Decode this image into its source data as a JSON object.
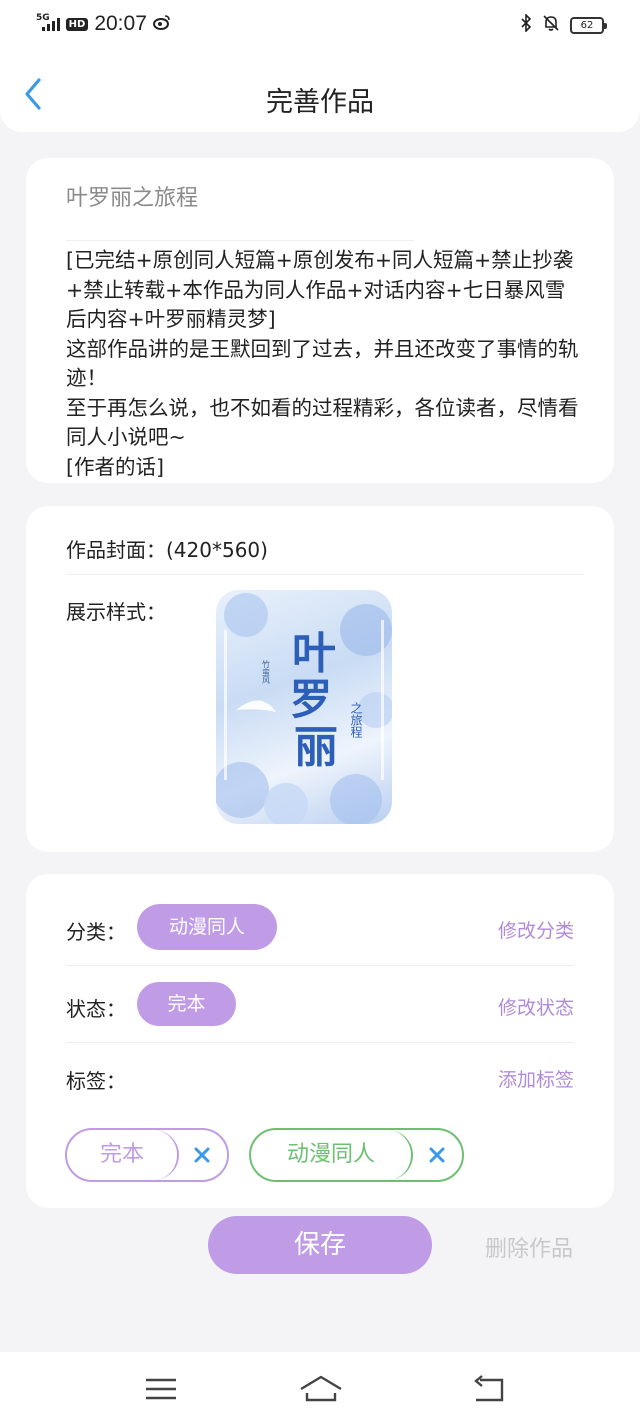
{
  "status_bar": {
    "network": "5G",
    "hd": "HD",
    "time": "20:07",
    "battery": "62",
    "icons": [
      "signal-icon",
      "weibo-icon",
      "bluetooth-icon",
      "mute-bell-icon",
      "battery-icon"
    ]
  },
  "header": {
    "title": "完善作品",
    "back_icon": "chevron-left-icon"
  },
  "work": {
    "title_placeholder": "叶罗丽之旅程",
    "description": "[已完结+原创同人短篇+原创发布+同人短篇+禁止抄袭+禁止转载+本作品为同人作品+对话内容+七日暴风雪后内容+叶罗丽精灵梦]\n这部作品讲的是王默回到了过去，并且还改变了事情的轨迹！\n至于再怎么说，也不如看的过程精彩，各位读者，尽情看同人小说吧~\n[作者的话]\n收藏加关注，后续作品不迷路。"
  },
  "cover": {
    "label": "作品封面：(420*560)",
    "style_label": "展示样式：",
    "image_title": "叶罗丽",
    "image_subtitle": "之旅程",
    "image_author": "竹蛮风"
  },
  "meta": {
    "category_label": "分类：",
    "category_value": "动漫同人",
    "category_action": "修改分类",
    "status_label": "状态：",
    "status_value": "完本",
    "status_action": "修改状态",
    "tags_label": "标签：",
    "tags_action": "添加标签",
    "tags": [
      {
        "text": "完本",
        "color": "#c09ce6"
      },
      {
        "text": "动漫同人",
        "color": "#6fbf73"
      }
    ],
    "remove_icon": "close-icon"
  },
  "actions": {
    "save": "保存",
    "delete": "删除作品"
  },
  "navbar": {
    "icons": [
      "menu-icon",
      "home-icon",
      "back-icon"
    ]
  },
  "colors": {
    "accent": "#c09ce6",
    "accent_text": "#b18bd9",
    "back_arrow": "#3b9ae8",
    "tag_green": "#6fbf73"
  }
}
